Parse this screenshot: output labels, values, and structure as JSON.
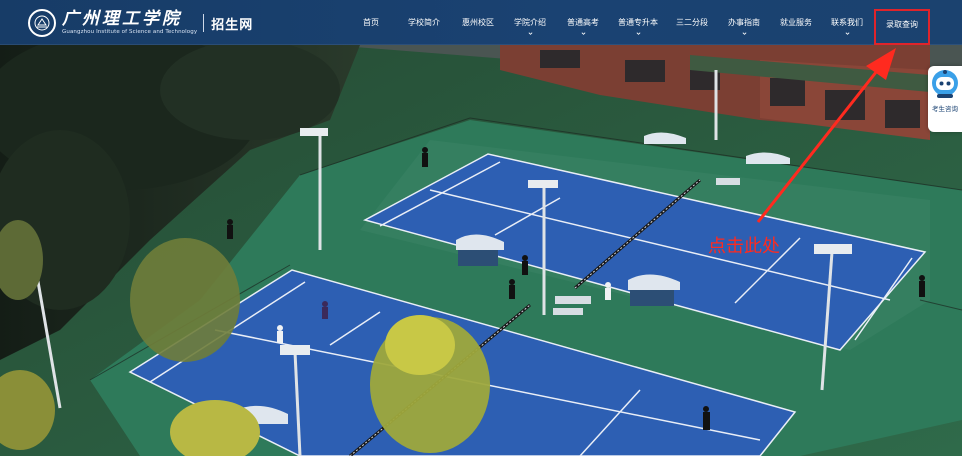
{
  "header": {
    "logo": {
      "name_cn": "广州理工学院",
      "name_en": "Guangzhou Institute of Science and Technology",
      "subtitle": "招生网"
    },
    "nav": [
      {
        "label": "首页",
        "dropdown": false
      },
      {
        "label": "学校简介",
        "dropdown": false
      },
      {
        "label": "惠州校区",
        "dropdown": false
      },
      {
        "label": "学院介绍",
        "dropdown": true
      },
      {
        "label": "普通高考",
        "dropdown": true
      },
      {
        "label": "普通专升本",
        "dropdown": true
      },
      {
        "label": "三二分段",
        "dropdown": false
      },
      {
        "label": "办事指南",
        "dropdown": true
      },
      {
        "label": "就业服务",
        "dropdown": false
      },
      {
        "label": "联系我们",
        "dropdown": true
      },
      {
        "label": "录取查询",
        "dropdown": false,
        "highlighted": true
      }
    ]
  },
  "annotation": {
    "text": "点击此处",
    "color": "#ff2a1f"
  },
  "consult_widget": {
    "label": "考生咨询",
    "icon": "robot-avatar-icon"
  },
  "colors": {
    "header_bg": "#1a4272",
    "court_blue": "#2d5fb3",
    "court_green": "#2e7a5a",
    "highlight_red": "#e0242b"
  }
}
